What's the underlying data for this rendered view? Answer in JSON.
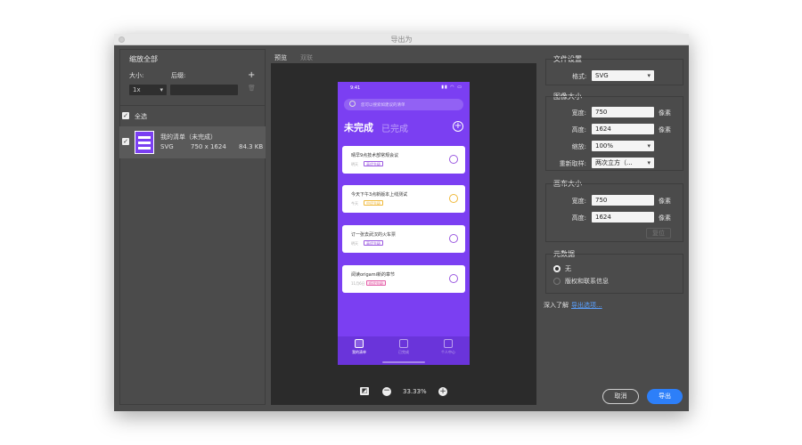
{
  "window": {
    "title": "导出为"
  },
  "left": {
    "scale_section": "缩放全部",
    "size_label": "大小:",
    "suffix_label": "后缀:",
    "size_value": "1x",
    "suffix_value": "",
    "add_icon": "plus-icon",
    "delete_icon": "trash-icon",
    "select_all": "全选",
    "asset": {
      "name": "我的清单（未完成）",
      "format": "SVG",
      "dimensions": "750 x 1624",
      "filesize": "84.3 KB"
    }
  },
  "preview": {
    "tabs": [
      "预览",
      "双联"
    ],
    "zoom": "33.33%",
    "phone": {
      "time": "9:41",
      "search_placeholder": "您可以搜索如建议的清单",
      "tab_active": "未完成",
      "tab_inactive": "已完成",
      "items": [
        {
          "title": "晴早9点技术部常规会议",
          "meta": "明天",
          "tag": "高优先级",
          "tag_color": "#9b59e0",
          "ring_color": "#9b59e0"
        },
        {
          "title": "今天下午3点新版本上线测试",
          "meta": "今天",
          "tag": "中优先级",
          "tag_color": "#f0b93a",
          "ring_color": "#f0b93a"
        },
        {
          "title": "订一张去武汉的火车票",
          "meta": "明天",
          "tag": "高优先级",
          "tag_color": "#9b59e0",
          "ring_color": "#9b59e0"
        },
        {
          "title": "阅读origami新的章节",
          "meta": "11月6日",
          "tag": "低优先级",
          "tag_color": "#e35fa8",
          "ring_color": "#9b59e0"
        }
      ],
      "tabbar": [
        "我的清单",
        "已完成",
        "个人中心"
      ]
    }
  },
  "right": {
    "file_settings": "文件设置",
    "format_label": "格式:",
    "format_value": "SVG",
    "image_size": "图像大小",
    "width_label": "宽度:",
    "width_value": "750",
    "height_label": "高度:",
    "height_value": "1624",
    "unit": "像素",
    "scale_label": "缩放:",
    "scale_value": "100%",
    "resample_label": "重新取样:",
    "resample_value": "两次立方（...",
    "canvas_size": "画布大小",
    "canvas_width_value": "750",
    "canvas_height_value": "1624",
    "reset": "复位",
    "metadata": "元数据",
    "meta_none": "无",
    "meta_copyright": "版权和联系信息",
    "learn_more": "深入了解",
    "export_options": "导出选项..."
  },
  "buttons": {
    "cancel": "取消",
    "export": "导出"
  },
  "colors": {
    "accent": "#2d7ff9",
    "phone_bg": "#7b3ff2"
  }
}
